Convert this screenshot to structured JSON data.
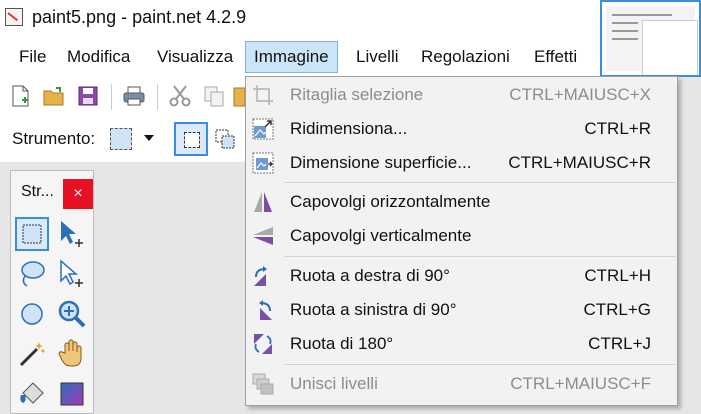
{
  "window": {
    "title": "paint5.png - paint.net 4.2.9"
  },
  "menubar": {
    "items": [
      {
        "label": "File"
      },
      {
        "label": "Modifica"
      },
      {
        "label": "Visualizza"
      },
      {
        "label": "Immagine",
        "active": true
      },
      {
        "label": "Livelli"
      },
      {
        "label": "Regolazioni"
      },
      {
        "label": "Effetti"
      }
    ]
  },
  "toolbar": {
    "icons": [
      "new-file-icon",
      "open-folder-icon",
      "save-icon",
      "print-icon",
      "cut-icon",
      "copy-icon",
      "paste-icon"
    ]
  },
  "tool_options": {
    "label": "Strumento:",
    "selected_tool_icon": "rectangle-select-icon"
  },
  "tools_panel": {
    "title": "Str...",
    "close_label": "×"
  },
  "image_menu": {
    "items": [
      {
        "label": "Ritaglia selezione",
        "shortcut": "CTRL+MAIUSC+X",
        "disabled": true,
        "icon": "crop-icon"
      },
      {
        "label": "Ridimensiona...",
        "shortcut": "CTRL+R",
        "disabled": false,
        "icon": "resize-icon"
      },
      {
        "label": "Dimensione superficie...",
        "shortcut": "CTRL+MAIUSC+R",
        "disabled": false,
        "icon": "canvas-size-icon"
      },
      {
        "label": "Capovolgi orizzontalmente",
        "shortcut": "",
        "disabled": false,
        "icon": "flip-horizontal-icon"
      },
      {
        "label": "Capovolgi verticalmente",
        "shortcut": "",
        "disabled": false,
        "icon": "flip-vertical-icon"
      },
      {
        "label": "Ruota a destra di 90°",
        "shortcut": "CTRL+H",
        "disabled": false,
        "icon": "rotate-right-icon"
      },
      {
        "label": "Ruota a sinistra di 90°",
        "shortcut": "CTRL+G",
        "disabled": false,
        "icon": "rotate-left-icon"
      },
      {
        "label": "Ruota di 180°",
        "shortcut": "CTRL+J",
        "disabled": false,
        "icon": "rotate-180-icon"
      },
      {
        "label": "Unisci livelli",
        "shortcut": "CTRL+MAIUSC+F",
        "disabled": true,
        "icon": "flatten-icon"
      }
    ]
  },
  "colors": {
    "menu_highlight": "#cce4f7",
    "accent": "#3a8ee0",
    "close_red": "#e81123",
    "icon_purple": "#7b4fa6",
    "disabled_text": "#8c8c8c"
  }
}
